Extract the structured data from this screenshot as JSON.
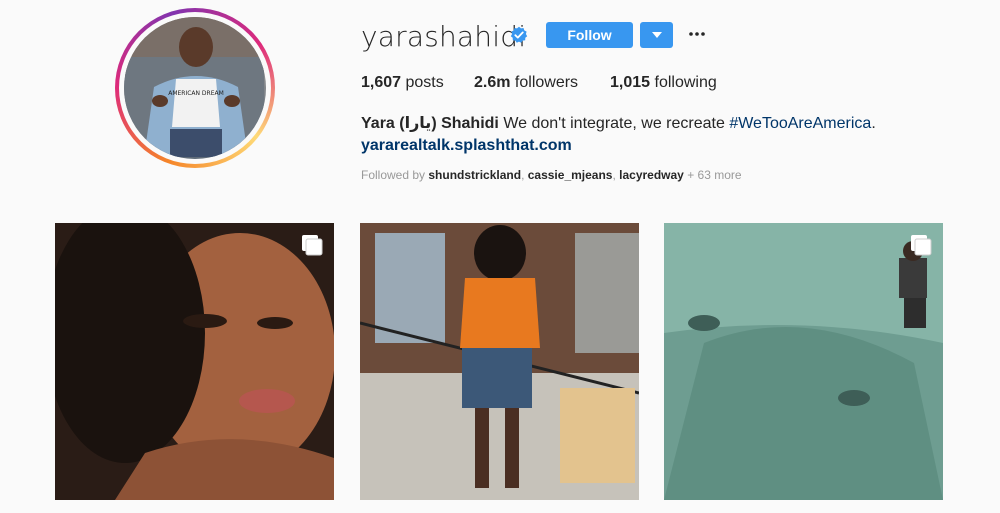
{
  "profile": {
    "username": "yarashahidi",
    "follow_label": "Follow",
    "stats": {
      "posts_count": "1,607",
      "posts_label": "posts",
      "followers_count": "2.6m",
      "followers_label": "followers",
      "following_count": "1,015",
      "following_label": "following"
    },
    "bio": {
      "name": "Yara (يارا) Shahidi",
      "text": "We don't integrate, we recreate",
      "hashtag": "#WeTooAreAmerica",
      "suffix": ".",
      "link": "yararealtalk.splashthat.com"
    },
    "followed_by": {
      "prefix": "Followed by",
      "users": [
        "shundstrickland",
        "cassie_mjeans",
        "lacyredway"
      ],
      "more": "+ 63 more"
    },
    "avatar_shirt_text": "AMERICAN DREAM"
  },
  "icons": {
    "verified": "verified-badge-icon",
    "dropdown": "chevron-down-icon",
    "more": "ellipsis-icon",
    "multi": "carousel-multi-icon"
  },
  "colors": {
    "accent": "#3897f0",
    "link": "#003569",
    "muted": "#999999"
  }
}
